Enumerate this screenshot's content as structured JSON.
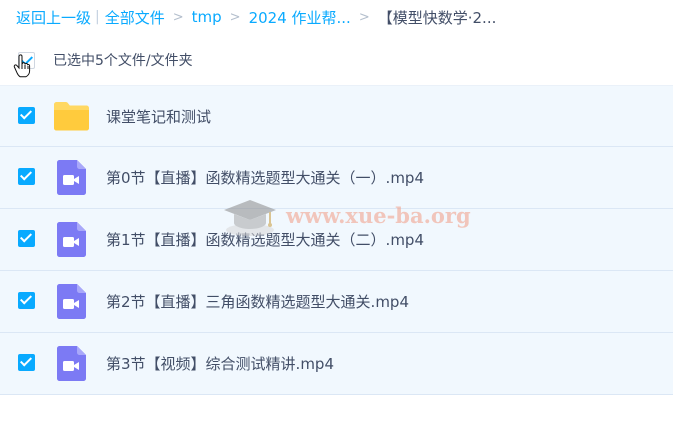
{
  "breadcrumb": {
    "back": "返回上一级",
    "divider": "|",
    "items": [
      "全部文件",
      "tmp",
      "2024 作业帮..."
    ],
    "separator": ">",
    "current": "【模型快数学·2..."
  },
  "selection": {
    "label": "已选中5个文件/文件夹",
    "all_checked": true
  },
  "files": [
    {
      "name": "课堂笔记和测试",
      "type": "folder",
      "checked": true
    },
    {
      "name": "第0节【直播】函数精选题型大通关（一）.mp4",
      "type": "video",
      "checked": true
    },
    {
      "name": "第1节【直播】函数精选题型大通关（二）.mp4",
      "type": "video",
      "checked": true
    },
    {
      "name": "第2节【直播】三角函数精选题型大通关.mp4",
      "type": "video",
      "checked": true
    },
    {
      "name": "第3节【视频】综合测试精讲.mp4",
      "type": "video",
      "checked": true
    }
  ],
  "watermark": {
    "text": "www.xue-ba.org"
  },
  "colors": {
    "link": "#09aaff",
    "text": "#424e67",
    "selected_row_bg": "#f1f8fe",
    "checkbox": "#09aaff",
    "folder": "#ffd862",
    "video": "#7c7af4",
    "watermark": "#f19d86"
  },
  "icons": {
    "folder": "folder-icon",
    "video": "video-file-icon",
    "cursor": "hand-cursor-icon"
  }
}
